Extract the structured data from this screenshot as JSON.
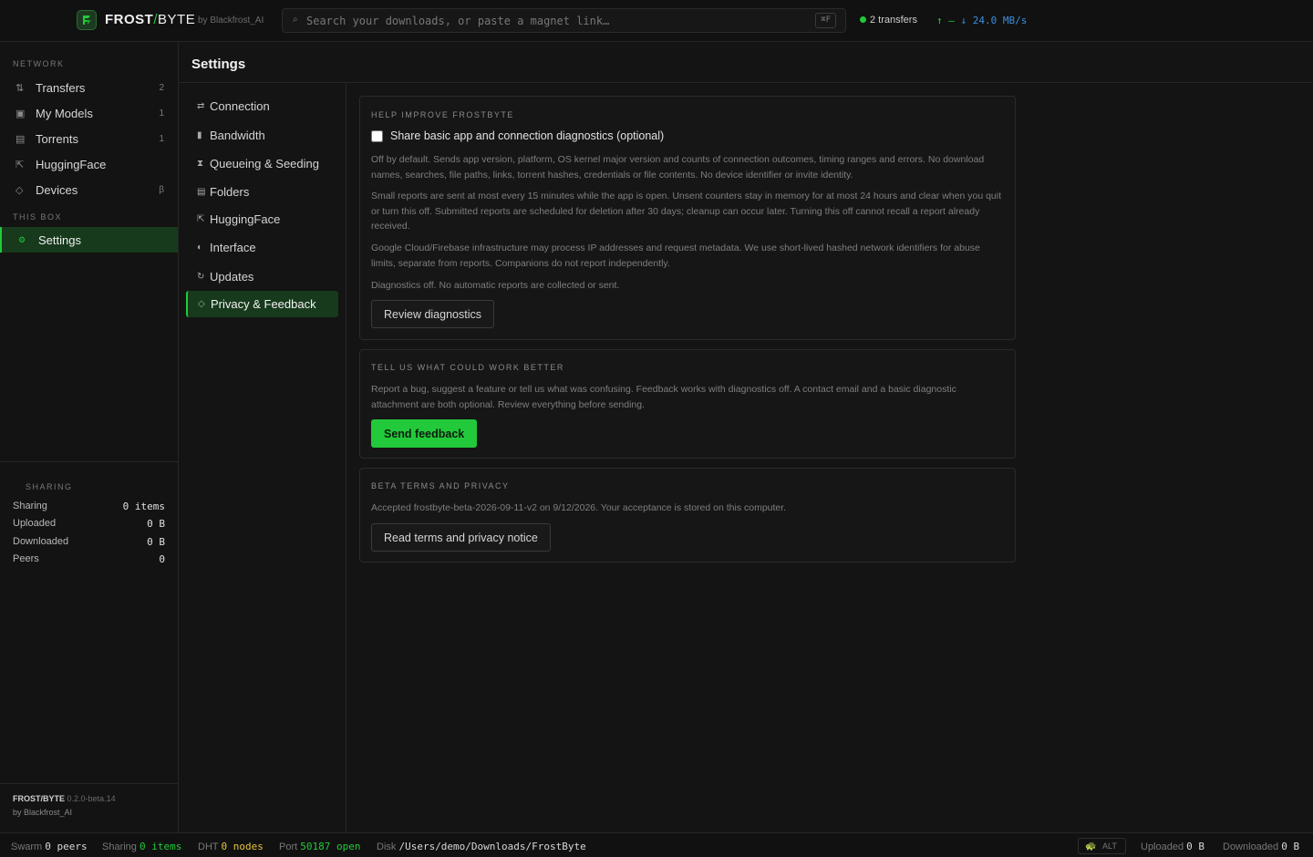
{
  "app": {
    "brand_frost": "FROST",
    "brand_slash": "/",
    "brand_byte": "BYTE",
    "brand_by": "by Blackfrost_AI",
    "accent": "#22c93a"
  },
  "search": {
    "placeholder": "Search your downloads, or paste a magnet link…",
    "shortcut": "⌘F",
    "icon": "search-icon"
  },
  "top_status": {
    "transfers": "2 transfers",
    "up_arrow": "↑",
    "up_value": "—",
    "down_arrow": "↓",
    "down_value": "24.0 MB/s"
  },
  "sidebar": {
    "network_label": "NETWORK",
    "network_items": [
      {
        "label": "Transfers",
        "count": "2",
        "icon": "transfer-arrows-icon",
        "glyph": "⇅"
      },
      {
        "label": "My Models",
        "count": "1",
        "icon": "model-box-icon",
        "glyph": "▣"
      },
      {
        "label": "Torrents",
        "count": "1",
        "icon": "torrent-icon",
        "glyph": "▤"
      },
      {
        "label": "HuggingFace",
        "count": "",
        "icon": "huggingface-icon",
        "glyph": "⇱"
      },
      {
        "label": "Devices",
        "count": "β",
        "icon": "diamond-icon",
        "glyph": "◇"
      }
    ],
    "this_box_label": "THIS BOX",
    "settings_item": {
      "label": "Settings",
      "icon": "gear-icon",
      "glyph": "⚙"
    },
    "sharing_label": "SHARING",
    "sharing_rows": [
      {
        "label": "Sharing",
        "value": "0 items"
      },
      {
        "label": "Uploaded",
        "value": "0 B"
      },
      {
        "label": "Downloaded",
        "value": "0 B"
      },
      {
        "label": "Peers",
        "value": "0"
      }
    ],
    "footer_name": "FROST/BYTE",
    "footer_version": "0.2.0-beta.14",
    "footer_by": "by Blackfrost_AI"
  },
  "settings": {
    "title": "Settings",
    "nav": [
      {
        "label": "Connection",
        "glyph": "⇄",
        "icon": "connection-icon"
      },
      {
        "label": "Bandwidth",
        "glyph": "▮",
        "icon": "bandwidth-icon"
      },
      {
        "label": "Queueing & Seeding",
        "glyph": "⧗",
        "icon": "hourglass-icon"
      },
      {
        "label": "Folders",
        "glyph": "▤",
        "icon": "folder-icon"
      },
      {
        "label": "HuggingFace",
        "glyph": "⇱",
        "icon": "huggingface-icon"
      },
      {
        "label": "Interface",
        "glyph": "◐",
        "icon": "interface-icon"
      },
      {
        "label": "Updates",
        "glyph": "↻",
        "icon": "refresh-icon"
      },
      {
        "label": "Privacy & Feedback",
        "glyph": "◇",
        "icon": "diamond-icon"
      }
    ],
    "active": "Privacy & Feedback"
  },
  "privacy": {
    "help_title": "HELP IMPROVE FROSTBYTE",
    "checkbox_label": "Share basic app and connection diagnostics (optional)",
    "checkbox_checked": false,
    "para1": "Off by default. Sends app version, platform, OS kernel major version and counts of connection outcomes, timing ranges and errors. No download names, searches, file paths, links, torrent hashes, credentials or file contents. No device identifier or invite identity.",
    "para2": "Small reports are sent at most every 15 minutes while the app is open. Unsent counters stay in memory for at most 24 hours and clear when you quit or turn this off. Submitted reports are scheduled for deletion after 30 days; cleanup can occur later. Turning this off cannot recall a report already received.",
    "para3": "Google Cloud/Firebase infrastructure may process IP addresses and request metadata. We use short-lived hashed network identifiers for abuse limits, separate from reports. Companions do not report independently.",
    "para4": "Diagnostics off. No automatic reports are collected or sent.",
    "review_button": "Review diagnostics",
    "feedback_title": "TELL US WHAT COULD WORK BETTER",
    "feedback_text": "Report a bug, suggest a feature or tell us what was confusing. Feedback works with diagnostics off. A contact email and a basic diagnostic attachment are both optional. Review everything before sending.",
    "feedback_button": "Send feedback",
    "terms_title": "BETA TERMS AND PRIVACY",
    "terms_text": "Accepted frostbyte-beta-2026-09-11-v2 on 9/12/2026. Your acceptance is stored on this computer.",
    "terms_button": "Read terms and privacy notice"
  },
  "statusbar": {
    "swarm_label": "Swarm",
    "swarm_value": "0 peers",
    "sharing_label": "Sharing",
    "sharing_value": "0 items",
    "dht_label": "DHT",
    "dht_value": "0 nodes",
    "port_label": "Port",
    "port_value": "50187 open",
    "disk_label": "Disk",
    "disk_value": "/Users/demo/Downloads/FrostByte",
    "alt_label": "ALT",
    "alt_icon": "turtle-icon",
    "uploaded_label": "Uploaded",
    "uploaded_value": "0 B",
    "downloaded_label": "Downloaded",
    "downloaded_value": "0 B"
  }
}
